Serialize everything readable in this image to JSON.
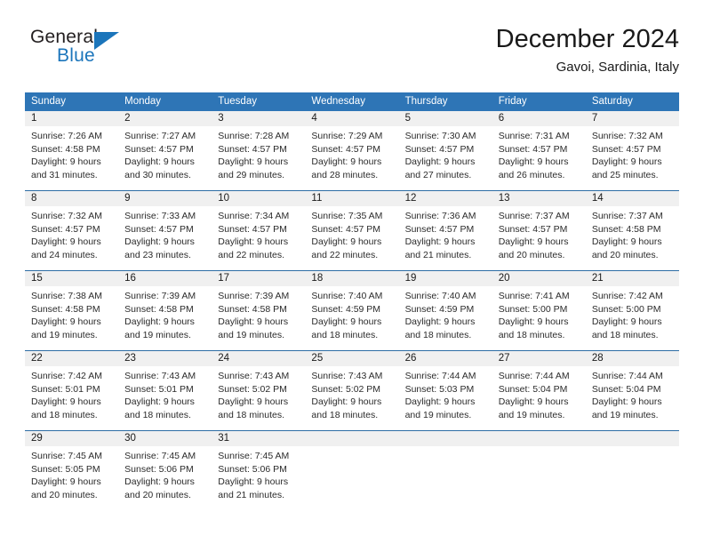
{
  "brand": {
    "word_one": "General",
    "word_two": "Blue",
    "triangle_icon": "triangle-icon",
    "accent_color": "#1b75bb"
  },
  "header": {
    "title": "December 2024",
    "location": "Gavoi, Sardinia, Italy"
  },
  "calendar": {
    "header_color": "#2e75b6",
    "row_divider_color": "#2e6da4",
    "day_band_color": "#f0f0f0",
    "weekdays": [
      "Sunday",
      "Monday",
      "Tuesday",
      "Wednesday",
      "Thursday",
      "Friday",
      "Saturday"
    ],
    "weeks": [
      [
        {
          "day": "1",
          "sunrise": "Sunrise: 7:26 AM",
          "sunset": "Sunset: 4:58 PM",
          "daylight_1": "Daylight: 9 hours",
          "daylight_2": "and 31 minutes."
        },
        {
          "day": "2",
          "sunrise": "Sunrise: 7:27 AM",
          "sunset": "Sunset: 4:57 PM",
          "daylight_1": "Daylight: 9 hours",
          "daylight_2": "and 30 minutes."
        },
        {
          "day": "3",
          "sunrise": "Sunrise: 7:28 AM",
          "sunset": "Sunset: 4:57 PM",
          "daylight_1": "Daylight: 9 hours",
          "daylight_2": "and 29 minutes."
        },
        {
          "day": "4",
          "sunrise": "Sunrise: 7:29 AM",
          "sunset": "Sunset: 4:57 PM",
          "daylight_1": "Daylight: 9 hours",
          "daylight_2": "and 28 minutes."
        },
        {
          "day": "5",
          "sunrise": "Sunrise: 7:30 AM",
          "sunset": "Sunset: 4:57 PM",
          "daylight_1": "Daylight: 9 hours",
          "daylight_2": "and 27 minutes."
        },
        {
          "day": "6",
          "sunrise": "Sunrise: 7:31 AM",
          "sunset": "Sunset: 4:57 PM",
          "daylight_1": "Daylight: 9 hours",
          "daylight_2": "and 26 minutes."
        },
        {
          "day": "7",
          "sunrise": "Sunrise: 7:32 AM",
          "sunset": "Sunset: 4:57 PM",
          "daylight_1": "Daylight: 9 hours",
          "daylight_2": "and 25 minutes."
        }
      ],
      [
        {
          "day": "8",
          "sunrise": "Sunrise: 7:32 AM",
          "sunset": "Sunset: 4:57 PM",
          "daylight_1": "Daylight: 9 hours",
          "daylight_2": "and 24 minutes."
        },
        {
          "day": "9",
          "sunrise": "Sunrise: 7:33 AM",
          "sunset": "Sunset: 4:57 PM",
          "daylight_1": "Daylight: 9 hours",
          "daylight_2": "and 23 minutes."
        },
        {
          "day": "10",
          "sunrise": "Sunrise: 7:34 AM",
          "sunset": "Sunset: 4:57 PM",
          "daylight_1": "Daylight: 9 hours",
          "daylight_2": "and 22 minutes."
        },
        {
          "day": "11",
          "sunrise": "Sunrise: 7:35 AM",
          "sunset": "Sunset: 4:57 PM",
          "daylight_1": "Daylight: 9 hours",
          "daylight_2": "and 22 minutes."
        },
        {
          "day": "12",
          "sunrise": "Sunrise: 7:36 AM",
          "sunset": "Sunset: 4:57 PM",
          "daylight_1": "Daylight: 9 hours",
          "daylight_2": "and 21 minutes."
        },
        {
          "day": "13",
          "sunrise": "Sunrise: 7:37 AM",
          "sunset": "Sunset: 4:57 PM",
          "daylight_1": "Daylight: 9 hours",
          "daylight_2": "and 20 minutes."
        },
        {
          "day": "14",
          "sunrise": "Sunrise: 7:37 AM",
          "sunset": "Sunset: 4:58 PM",
          "daylight_1": "Daylight: 9 hours",
          "daylight_2": "and 20 minutes."
        }
      ],
      [
        {
          "day": "15",
          "sunrise": "Sunrise: 7:38 AM",
          "sunset": "Sunset: 4:58 PM",
          "daylight_1": "Daylight: 9 hours",
          "daylight_2": "and 19 minutes."
        },
        {
          "day": "16",
          "sunrise": "Sunrise: 7:39 AM",
          "sunset": "Sunset: 4:58 PM",
          "daylight_1": "Daylight: 9 hours",
          "daylight_2": "and 19 minutes."
        },
        {
          "day": "17",
          "sunrise": "Sunrise: 7:39 AM",
          "sunset": "Sunset: 4:58 PM",
          "daylight_1": "Daylight: 9 hours",
          "daylight_2": "and 19 minutes."
        },
        {
          "day": "18",
          "sunrise": "Sunrise: 7:40 AM",
          "sunset": "Sunset: 4:59 PM",
          "daylight_1": "Daylight: 9 hours",
          "daylight_2": "and 18 minutes."
        },
        {
          "day": "19",
          "sunrise": "Sunrise: 7:40 AM",
          "sunset": "Sunset: 4:59 PM",
          "daylight_1": "Daylight: 9 hours",
          "daylight_2": "and 18 minutes."
        },
        {
          "day": "20",
          "sunrise": "Sunrise: 7:41 AM",
          "sunset": "Sunset: 5:00 PM",
          "daylight_1": "Daylight: 9 hours",
          "daylight_2": "and 18 minutes."
        },
        {
          "day": "21",
          "sunrise": "Sunrise: 7:42 AM",
          "sunset": "Sunset: 5:00 PM",
          "daylight_1": "Daylight: 9 hours",
          "daylight_2": "and 18 minutes."
        }
      ],
      [
        {
          "day": "22",
          "sunrise": "Sunrise: 7:42 AM",
          "sunset": "Sunset: 5:01 PM",
          "daylight_1": "Daylight: 9 hours",
          "daylight_2": "and 18 minutes."
        },
        {
          "day": "23",
          "sunrise": "Sunrise: 7:43 AM",
          "sunset": "Sunset: 5:01 PM",
          "daylight_1": "Daylight: 9 hours",
          "daylight_2": "and 18 minutes."
        },
        {
          "day": "24",
          "sunrise": "Sunrise: 7:43 AM",
          "sunset": "Sunset: 5:02 PM",
          "daylight_1": "Daylight: 9 hours",
          "daylight_2": "and 18 minutes."
        },
        {
          "day": "25",
          "sunrise": "Sunrise: 7:43 AM",
          "sunset": "Sunset: 5:02 PM",
          "daylight_1": "Daylight: 9 hours",
          "daylight_2": "and 18 minutes."
        },
        {
          "day": "26",
          "sunrise": "Sunrise: 7:44 AM",
          "sunset": "Sunset: 5:03 PM",
          "daylight_1": "Daylight: 9 hours",
          "daylight_2": "and 19 minutes."
        },
        {
          "day": "27",
          "sunrise": "Sunrise: 7:44 AM",
          "sunset": "Sunset: 5:04 PM",
          "daylight_1": "Daylight: 9 hours",
          "daylight_2": "and 19 minutes."
        },
        {
          "day": "28",
          "sunrise": "Sunrise: 7:44 AM",
          "sunset": "Sunset: 5:04 PM",
          "daylight_1": "Daylight: 9 hours",
          "daylight_2": "and 19 minutes."
        }
      ],
      [
        {
          "day": "29",
          "sunrise": "Sunrise: 7:45 AM",
          "sunset": "Sunset: 5:05 PM",
          "daylight_1": "Daylight: 9 hours",
          "daylight_2": "and 20 minutes."
        },
        {
          "day": "30",
          "sunrise": "Sunrise: 7:45 AM",
          "sunset": "Sunset: 5:06 PM",
          "daylight_1": "Daylight: 9 hours",
          "daylight_2": "and 20 minutes."
        },
        {
          "day": "31",
          "sunrise": "Sunrise: 7:45 AM",
          "sunset": "Sunset: 5:06 PM",
          "daylight_1": "Daylight: 9 hours",
          "daylight_2": "and 21 minutes."
        },
        {
          "day": "",
          "sunrise": "",
          "sunset": "",
          "daylight_1": "",
          "daylight_2": ""
        },
        {
          "day": "",
          "sunrise": "",
          "sunset": "",
          "daylight_1": "",
          "daylight_2": ""
        },
        {
          "day": "",
          "sunrise": "",
          "sunset": "",
          "daylight_1": "",
          "daylight_2": ""
        },
        {
          "day": "",
          "sunrise": "",
          "sunset": "",
          "daylight_1": "",
          "daylight_2": ""
        }
      ]
    ]
  }
}
